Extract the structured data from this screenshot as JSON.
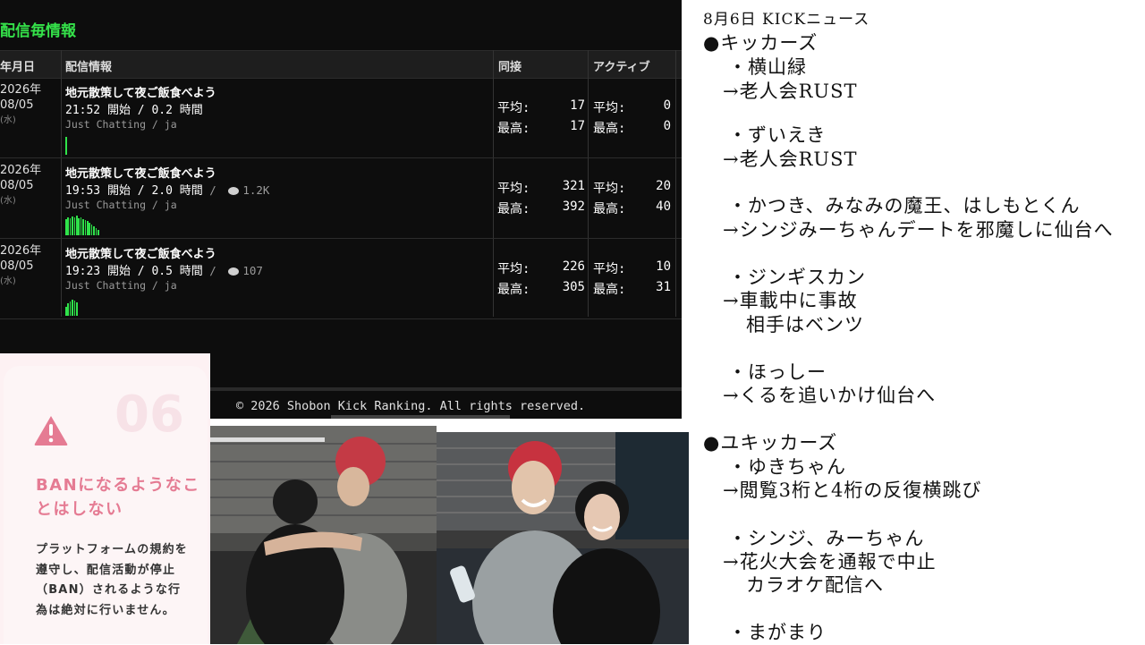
{
  "stats": {
    "title": "配信毎情報",
    "headers": {
      "date": "年月日",
      "info": "配信情報",
      "viewers": "同接",
      "active": "アクティブ"
    },
    "rows": [
      {
        "year": "2026年",
        "md": "08/05",
        "dow": "(水)",
        "title": "地元散策して夜ご飯食べよう",
        "start": "21:52 開始 / 0.2 時間",
        "chat": "",
        "category": "Just Chatting / ja",
        "avg_label": "平均:",
        "max_label": "最高:",
        "avg": "17",
        "max": "17",
        "act_avg": "0",
        "act_max": "0"
      },
      {
        "year": "2026年",
        "md": "08/05",
        "dow": "(水)",
        "title": "地元散策して夜ご飯食べよう",
        "start": "19:53 開始 / 2.0 時間",
        "chat": "1.2K",
        "category": "Just Chatting / ja",
        "avg_label": "平均:",
        "max_label": "最高:",
        "avg": "321",
        "max": "392",
        "act_avg": "20",
        "act_max": "40"
      },
      {
        "year": "2026年",
        "md": "08/05",
        "dow": "(水)",
        "title": "地元散策して夜ご飯食べよう",
        "start": "19:23 開始 / 0.5 時間",
        "chat": "107",
        "category": "Just Chatting / ja",
        "avg_label": "平均:",
        "max_label": "最高:",
        "avg": "226",
        "max": "305",
        "act_avg": "10",
        "act_max": "31"
      }
    ],
    "footer": "© 2026 Shobon Kick Ranking. All rights reserved."
  },
  "rule_card": {
    "number": "06",
    "heading": "BANになるようなことはしない",
    "text": "プラットフォームの規約を遵守し、配信活動が停止（BAN）されるような行為は絶対に行いません。"
  },
  "news": {
    "title": "8月6日 KICKニュース",
    "lines": [
      "●キッカーズ",
      "・横山緑",
      "→老人会RUST",
      "・ずいえき",
      "→老人会RUST",
      "・かつき、みなみの魔王、はしもとくん",
      "→シンジみーちゃんデートを邪魔しに仙台へ",
      "・ジンギスカン",
      "→車載中に事故",
      "相手はベンツ",
      "・ほっしー",
      "→くるを追いかけ仙台へ",
      "●ユキッカーズ",
      "・ゆきちゃん",
      "→閲覧3桁と4桁の反復横跳び",
      "・シンジ、みーちゃん",
      "→花火大会を通報で中止",
      "カラオケ配信へ",
      "・まがまり"
    ]
  },
  "colors": {
    "accent_green": "#35e24a",
    "card_pink": "#e57b93",
    "panel_bg": "#0d0d0d"
  }
}
